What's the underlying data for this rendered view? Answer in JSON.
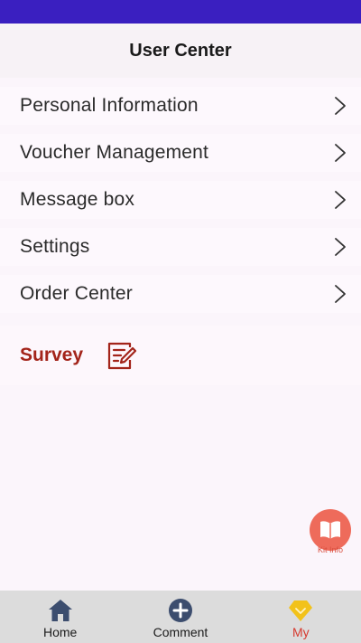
{
  "header": {
    "title": "User Center"
  },
  "menu": {
    "items": [
      {
        "label": "Personal Information",
        "icon": "chevron-right-icon"
      },
      {
        "label": "Voucher Management",
        "icon": "chevron-right-icon"
      },
      {
        "label": "Message box",
        "icon": "chevron-right-icon"
      },
      {
        "label": "Settings",
        "icon": "chevron-right-icon"
      },
      {
        "label": "Order Center",
        "icon": "chevron-right-icon"
      }
    ]
  },
  "survey": {
    "label": "Survey",
    "icon": "edit-document-icon"
  },
  "kit_info": {
    "label": "Kit Info",
    "icon": "book-icon"
  },
  "bottom_nav": {
    "items": [
      {
        "label": "Home",
        "icon": "home-icon",
        "active": false
      },
      {
        "label": "Comment",
        "icon": "plus-circle-icon",
        "active": false
      },
      {
        "label": "My",
        "icon": "diamond-icon",
        "active": true
      }
    ]
  },
  "colors": {
    "status_bar": "#3a1fc0",
    "survey_text": "#a3241a",
    "accent": "#ee6b5b",
    "active_nav": "#d63a2f",
    "nav_icon": "#3c4d6e",
    "diamond": "#f2c21a"
  }
}
